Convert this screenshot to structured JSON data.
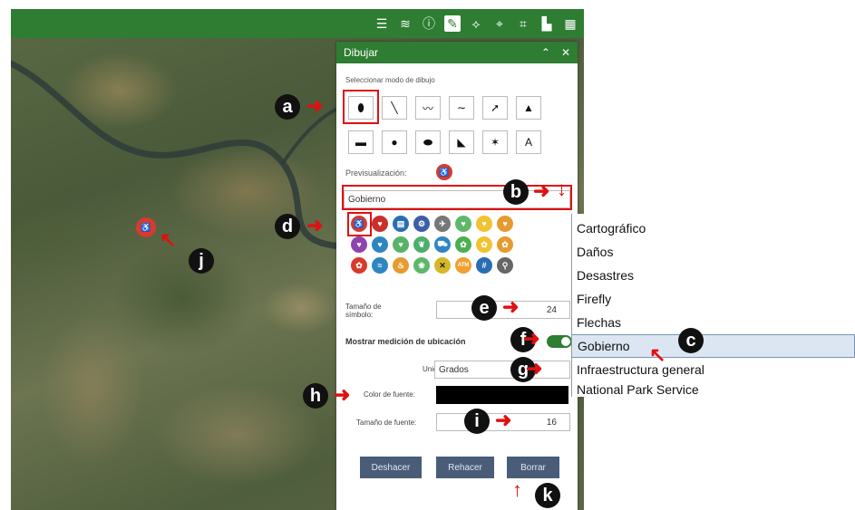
{
  "panel": {
    "title": "Dibujar",
    "collapse_icon": "chevron-up-icon",
    "close_icon": "close-icon",
    "mode_label": "Seleccionar modo de dibujo",
    "modes_row1": [
      "●",
      "╲",
      "〜",
      "∼",
      "➚",
      "▲"
    ],
    "modes_row2": [
      "▬",
      "●",
      "⬬",
      "◣",
      "✶",
      "A"
    ],
    "preview_label": "Previsualización:",
    "category_value": "Gobierno",
    "size_label": "Tamaño de símbolo:",
    "size_value": "24",
    "measure_label": "Mostrar medición de ubicación",
    "unit_label": "Unidad:",
    "unit_value": "Grados",
    "font_color_label": "Color de fuente:",
    "font_size_label": "Tamaño de fuente:",
    "font_size_value": "16",
    "buttons": {
      "undo": "Deshacer",
      "redo": "Rehacer",
      "clear": "Borrar"
    }
  },
  "dropdown": {
    "items": [
      "Cartográfico",
      "Daños",
      "Desastres",
      "Firefly",
      "Flechas",
      "Gobierno",
      "Infraestructura general",
      "National Park Service"
    ],
    "selected": "Gobierno"
  },
  "annotations": [
    "a",
    "b",
    "c",
    "d",
    "e",
    "f",
    "g",
    "h",
    "i",
    "j",
    "k"
  ],
  "colors": {
    "accent": "#2e7d32",
    "annotation": "#e01010",
    "button": "#4a5d78"
  }
}
